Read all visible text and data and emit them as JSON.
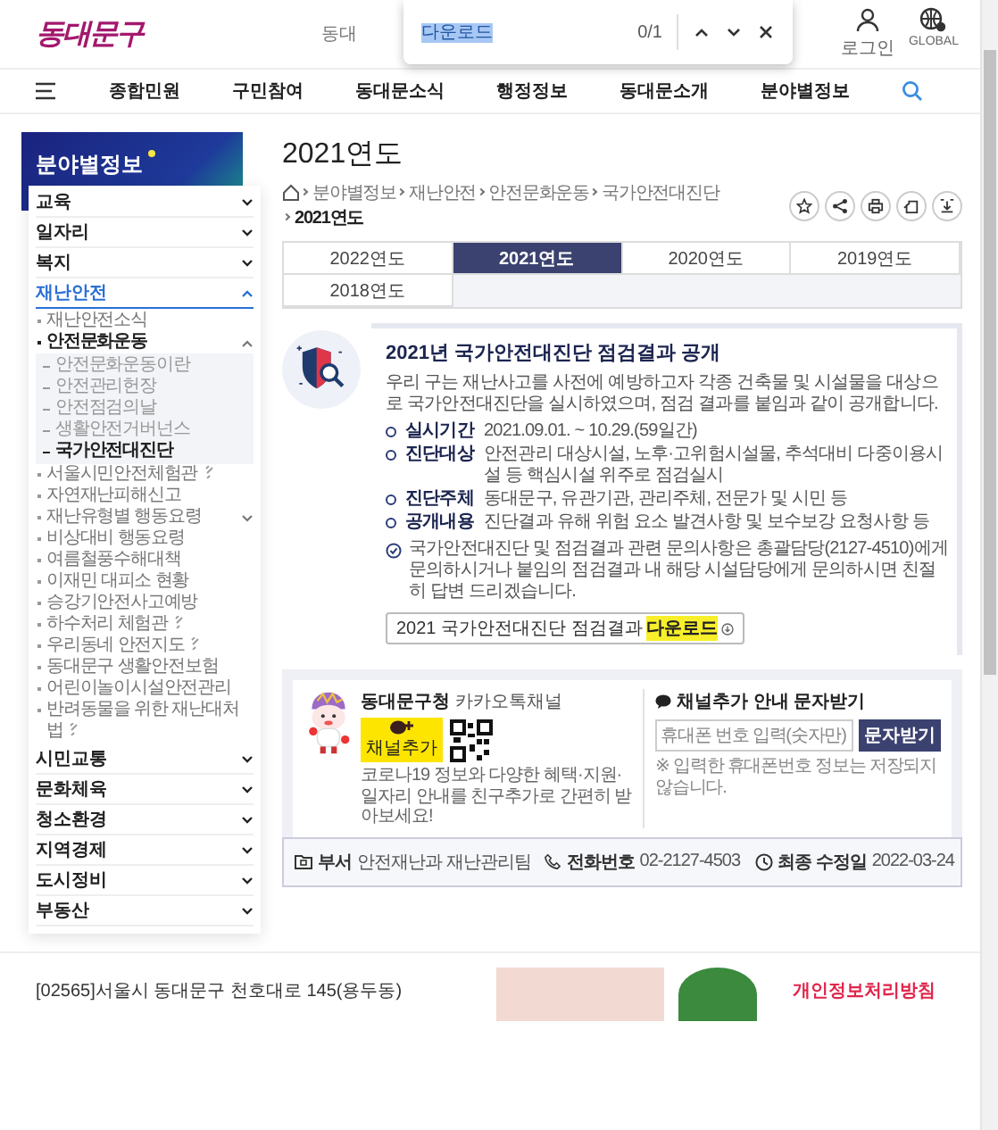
{
  "header": {
    "logo": "동대문구",
    "search_placeholder": "동대",
    "login": "로그인",
    "global": "GLOBAL"
  },
  "find_bar": {
    "query": "다운로드",
    "count": "0/1"
  },
  "nav": [
    "종합민원",
    "구민참여",
    "동대문소식",
    "행정정보",
    "동대문소개",
    "분야별정보"
  ],
  "sidebar": {
    "title": "분야별정보",
    "items": [
      {
        "label": "교육",
        "expanded": false,
        "selected": false
      },
      {
        "label": "일자리",
        "expanded": false,
        "selected": false
      },
      {
        "label": "복지",
        "expanded": false,
        "selected": false
      },
      {
        "label": "재난안전",
        "expanded": true,
        "selected": true,
        "children": [
          {
            "label": "재난안전소식",
            "kind": "page",
            "selected": false
          },
          {
            "label": "안전문화운동",
            "kind": "folder",
            "expanded": true,
            "selected": true,
            "children": [
              {
                "label": "안전문화운동이란",
                "selected": false
              },
              {
                "label": "안전관리헌장",
                "selected": false
              },
              {
                "label": "안전점검의날",
                "selected": false
              },
              {
                "label": "생활안전거버넌스",
                "selected": false
              },
              {
                "label": "국가안전대진단",
                "selected": true
              }
            ]
          },
          {
            "label": "서울시민안전체험관",
            "kind": "external",
            "selected": false
          },
          {
            "label": "자연재난피해신고",
            "kind": "page",
            "selected": false
          },
          {
            "label": "재난유형별 행동요령",
            "kind": "folder",
            "expanded": false,
            "selected": false
          },
          {
            "label": "비상대비 행동요령",
            "kind": "page",
            "selected": false
          },
          {
            "label": "여름철풍수해대책",
            "kind": "page",
            "selected": false
          },
          {
            "label": "이재민 대피소 현황",
            "kind": "page",
            "selected": false
          },
          {
            "label": "승강기안전사고예방",
            "kind": "page",
            "selected": false
          },
          {
            "label": "하수처리 체험관",
            "kind": "external",
            "selected": false
          },
          {
            "label": "우리동네 안전지도",
            "kind": "external",
            "selected": false
          },
          {
            "label": "동대문구 생활안전보험",
            "kind": "page",
            "selected": false
          },
          {
            "label": "어린이놀이시설안전관리",
            "kind": "page",
            "selected": false
          },
          {
            "label": "반려동물을 위한 재난대처법",
            "kind": "external",
            "selected": false
          }
        ]
      },
      {
        "label": "시민교통",
        "expanded": false,
        "selected": false
      },
      {
        "label": "문화체육",
        "expanded": false,
        "selected": false
      },
      {
        "label": "청소환경",
        "expanded": false,
        "selected": false
      },
      {
        "label": "지역경제",
        "expanded": false,
        "selected": false
      },
      {
        "label": "도시정비",
        "expanded": false,
        "selected": false
      },
      {
        "label": "부동산",
        "expanded": false,
        "selected": false
      }
    ]
  },
  "page_title": "2021연도",
  "breadcrumb": [
    "분야별정보",
    "재난안전",
    "안전문화운동",
    "국가안전대진단",
    "2021연도"
  ],
  "tabs": [
    {
      "label": "2022연도",
      "selected": false
    },
    {
      "label": "2021연도",
      "selected": true
    },
    {
      "label": "2020연도",
      "selected": false
    },
    {
      "label": "2019연도",
      "selected": false
    },
    {
      "label": "2018연도",
      "selected": false
    }
  ],
  "notice": {
    "title": "2021년 국가안전대진단 점검결과 공개",
    "intro": "우리 구는 재난사고를 사전에 예방하고자 각종 건축물 및 시설물을 대상으로 국가안전대진단을 실시하였으며, 점검 결과를 붙임과 같이 공개합니다.",
    "items": [
      {
        "label": "실시기간",
        "text": "2021.09.01. ~ 10.29.(59일간)"
      },
      {
        "label": "진단대상",
        "text": "안전관리 대상시설, 노후·고위험시설물, 추석대비 다중이용시설 등 핵심시설 위주로 점검실시"
      },
      {
        "label": "진단주체",
        "text": "동대문구, 유관기관, 관리주체, 전문가 및 시민 등"
      },
      {
        "label": "공개내용",
        "text": "진단결과 유해 위험 요소 발견사항 및 보수보강 요청사항 등"
      }
    ],
    "note": "국가안전대진단 및 점검결과 관련 문의사항은 총괄담당(2127-4510)에게 문의하시거나 붙임의 점검결과 내 해당 시설담당에게 문의하시면 친절히 답변 드리겠습니다.",
    "download": {
      "text": "2021 국가안전대진단 점검결과",
      "highlight": "다운로드"
    }
  },
  "kakao": {
    "title": "**동대문구청** 카카오톡채널",
    "badge": "채널추가",
    "desc": "코로나19 정보와 다양한 혜택·지원·일자리 안내를 친구추가로 간편히 받아보세요!",
    "sms_title": "채널추가 안내 문자받기",
    "placeholder": "휴대폰 번호 입력(숫자만)",
    "button": "문자받기",
    "note": "※ 입력한 휴대폰번호 정보는 저장되지 않습니다."
  },
  "info": [
    {
      "kind": "department",
      "label": "부서",
      "value": "안전재난과 재난관리팀"
    },
    {
      "kind": "phone",
      "label": "전화번호",
      "value": "02-2127-4503"
    },
    {
      "kind": "updated",
      "label": "최종 수정일",
      "value": "2022-03-24"
    }
  ],
  "footer": {
    "address": "[02565]서울시 동대문구 천호대로 145(용두동)",
    "privacy": "개인정보처리방침"
  }
}
